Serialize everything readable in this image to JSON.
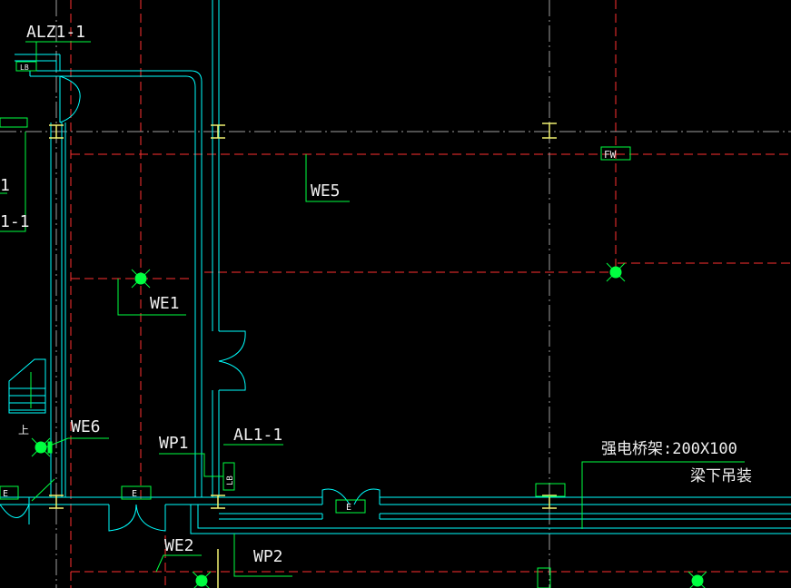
{
  "labels": {
    "alz1_1": "ALZ1-1",
    "we5": "WE5",
    "we1": "WE1",
    "we6": "WE6",
    "wp1": "WP1",
    "al1_1": "AL1-1",
    "we2": "WE2",
    "wp2": "WP2",
    "tray_line1": "强电桥架:200X100",
    "tray_line2": "梁下吊装",
    "fw_box": "FW",
    "lb_top": "LB",
    "lb_mid": "LB",
    "box_e_left": "E",
    "box_e_mid": "E",
    "box_e_right": "E",
    "partial_1": "1",
    "partial_1_1": "1-1",
    "stair_up": "上"
  },
  "colors": {
    "background": "#000000",
    "wall": "#00ffff",
    "axis": "#ff3030",
    "annotation": "#00ff40",
    "label_text": "#f0f0f0",
    "fixture": "#f0f070"
  }
}
